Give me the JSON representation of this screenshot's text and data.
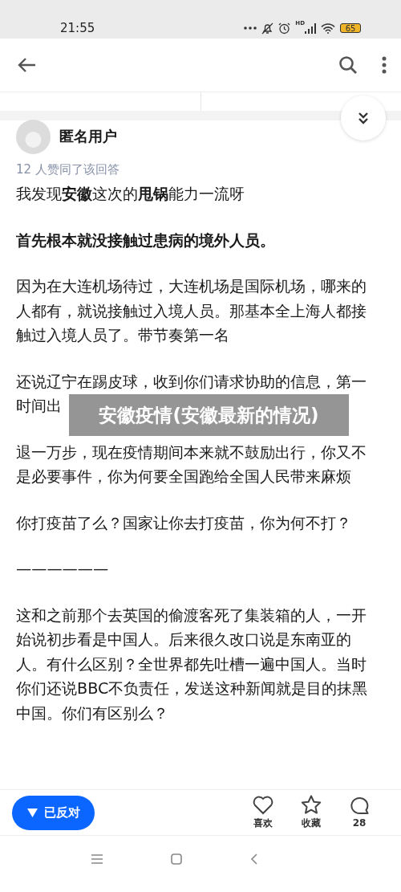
{
  "status_bar": {
    "time": "21:55",
    "network": "HD",
    "battery": "65"
  },
  "author": {
    "name": "匿名用户"
  },
  "votes": "12 人赞同了该回答",
  "paragraphs": [
    {
      "text": "我发现**安徽**这次的**甩锅**能力一流呀",
      "bold": false
    },
    {
      "text": "首先根本就没接触过患病的境外人员。",
      "bold": true
    },
    {
      "text": "因为在大连机场待过，大连机场是国际机场，哪来的人都有，就说接触过入境人员。那基本全上海人都接触过入境人员了。带节奏第一名",
      "bold": false
    },
    {
      "lines": [
        "还说辽宁在踢皮球，收到你们请求协助的信息，第一",
        "时间出"
      ],
      "bold": false
    },
    {
      "text": "退一万步，现在疫情期间本来就不鼓励出行，你又不是必要事件，你为何要全国跑给全国人民带来麻烦",
      "bold": false
    },
    {
      "text": "你打疫苗了么？国家让你去打疫苗，你为何不打？",
      "bold": false
    },
    {
      "text": "——————",
      "bold": false
    },
    {
      "text": "这和之前那个去英国的偷渡客死了集装箱的人，一开始说初步看是中国人。后来很久改口说是东南亚的人。有什么区别？全世界都先吐槽一遍中国人。当时你们还说BBC不负责任，发送这种新闻就是目的抹黑中国。你们有区别么？",
      "bold": false
    }
  ],
  "overlay_title": "安徽疫情(安徽最新的情况)",
  "actions": {
    "oppose": {
      "label": "已反对",
      "selected": true
    },
    "like": "喜欢",
    "favorite": "收藏",
    "comments": "28"
  }
}
